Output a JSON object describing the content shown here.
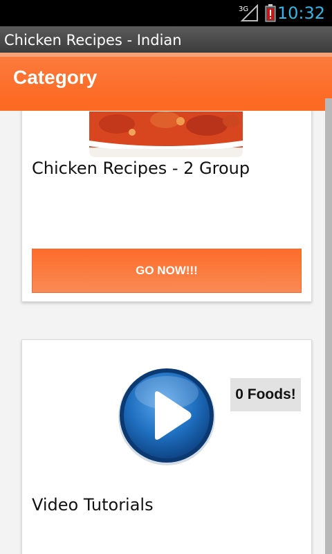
{
  "status_bar": {
    "time": "10:32",
    "network": "3G",
    "icons": [
      "signal-icon",
      "battery-icon"
    ]
  },
  "app": {
    "window_title": "Chicken Recipes - Indian",
    "action_bar_title": "Category"
  },
  "cards": [
    {
      "title": "Chicken Recipes - 2 Group",
      "button_label": "GO NOW!!!",
      "image": "chicken-curry-image"
    },
    {
      "title": "Video Tutorials",
      "badge": "0 Foods!",
      "image": "play-icon"
    }
  ],
  "colors": {
    "accent": "#fd6a24",
    "status_text": "#33b5e5",
    "play_blue": "#1f6fc0"
  }
}
